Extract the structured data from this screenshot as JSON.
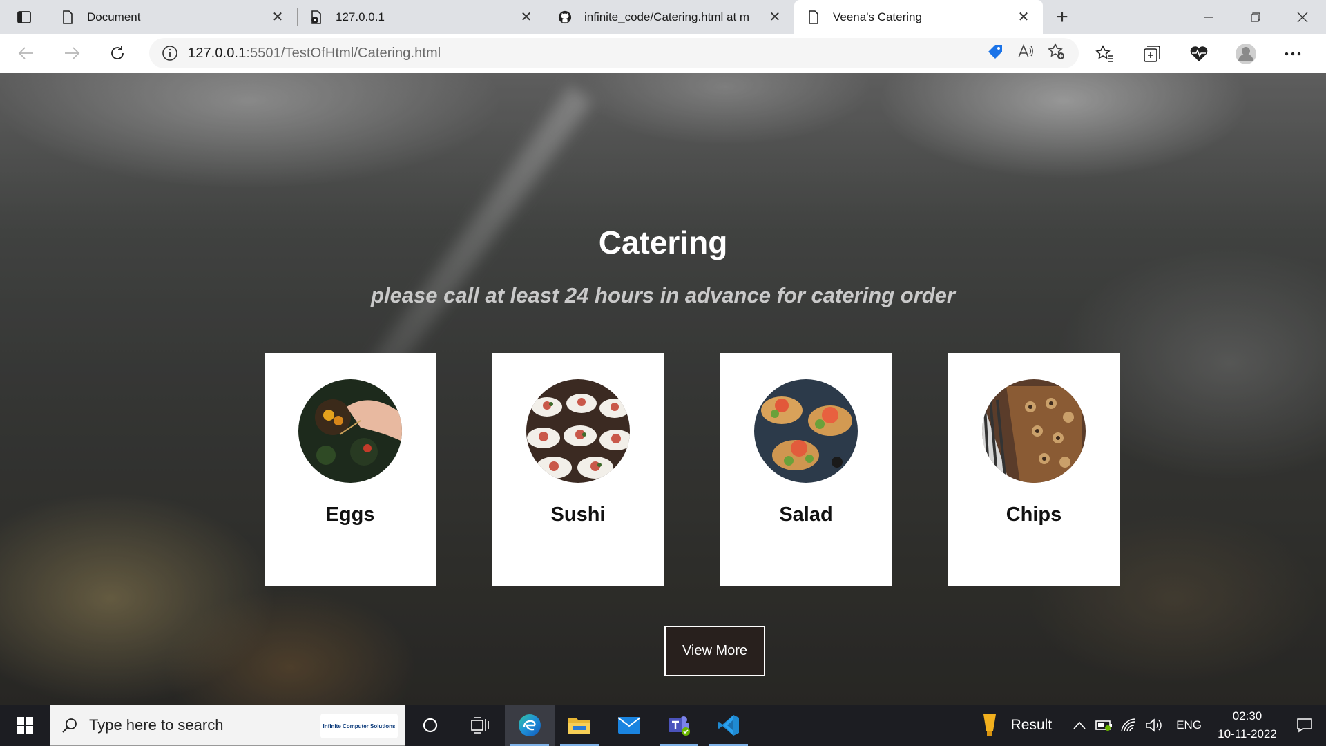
{
  "browser": {
    "tabs": [
      {
        "title": "Document",
        "icon": "page-icon",
        "active": false
      },
      {
        "title": "127.0.0.1",
        "icon": "blocked-page-icon",
        "active": false
      },
      {
        "title": "infinite_code/Catering.html at m",
        "icon": "github-icon",
        "active": false
      },
      {
        "title": "Veena's Catering",
        "icon": "page-icon",
        "active": true
      }
    ],
    "address": {
      "host": "127.0.0.1",
      "path": ":5501/TestOfHtml/Catering.html"
    }
  },
  "page": {
    "title": "Catering",
    "subtitle": "please call at least 24 hours in advance for catering order",
    "cards": [
      {
        "name": "Eggs",
        "image": "eggs-photo"
      },
      {
        "name": "Sushi",
        "image": "sushi-photo"
      },
      {
        "name": "Salad",
        "image": "salad-photo"
      },
      {
        "name": "Chips",
        "image": "chips-photo"
      }
    ],
    "view_more_label": "View More"
  },
  "taskbar": {
    "search_placeholder": "Type here to search",
    "search_badge": "Infinite Computer Solutions",
    "apps": [
      "cortana-icon",
      "task-view-icon",
      "edge-icon",
      "file-explorer-icon",
      "mail-icon",
      "teams-icon",
      "vscode-icon"
    ],
    "weather_label": "Result",
    "language": "ENG",
    "time": "02:30",
    "date": "10-11-2022"
  }
}
